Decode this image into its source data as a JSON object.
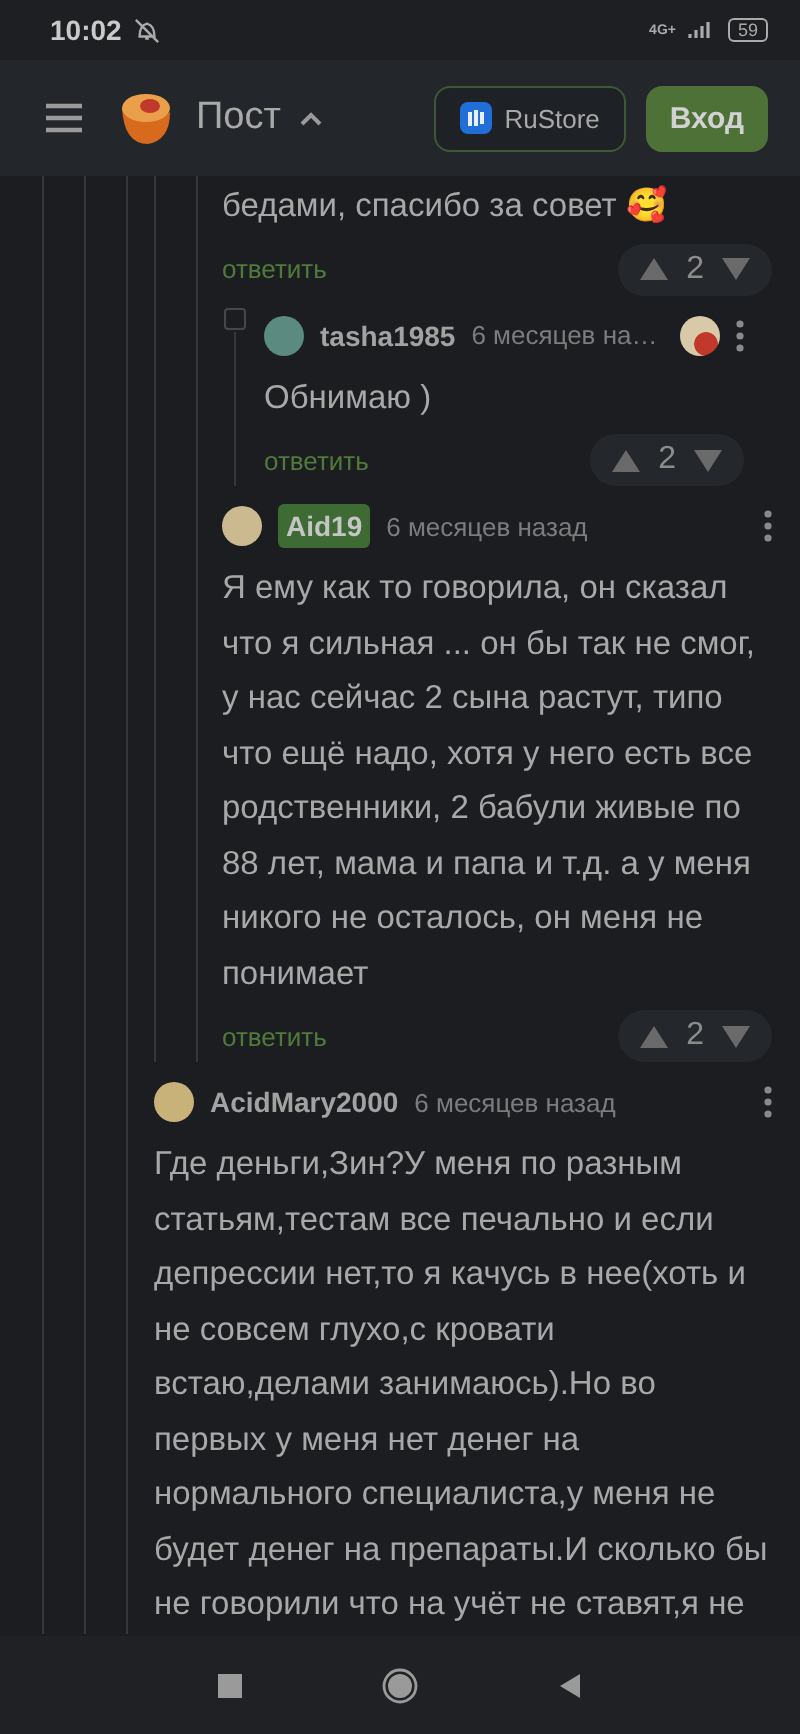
{
  "status_bar": {
    "time": "10:02",
    "battery": "59",
    "network": "4G+"
  },
  "header": {
    "title": "Пост",
    "store_button": "RuStore",
    "login_button": "Вход"
  },
  "upper_replies": [
    {
      "kind": "partial",
      "text": "бедами, спасибо за совет 🥰",
      "reply": "ответить",
      "score": "2",
      "children": [
        {
          "kind": "comment",
          "author": "tasha1985",
          "author_badge": false,
          "time": "6 месяцев на…",
          "reaction_avatar": true,
          "text": "Обнимаю )",
          "reply": "ответить",
          "score": "2"
        }
      ]
    },
    {
      "kind": "comment",
      "author": "Aid19",
      "author_badge": true,
      "time": "6 месяцев назад",
      "reaction_avatar": false,
      "text": "Я ему как то говорила, он сказал что я сильная ... он бы так не смог, у нас сейчас 2 сына растут, типо что ещё надо, хотя у него есть все родственники, 2 бабули живые по 88 лет, мама и папа и т.д. а у меня никого не осталось, он меня не понимает",
      "reply": "ответить",
      "score": "2"
    }
  ],
  "comments": [
    {
      "kind": "comment",
      "author": "AcidMary2000",
      "author_badge": false,
      "time": "6 месяцев назад",
      "reaction_avatar": false,
      "text": "Где деньги,Зин?У меня по разным статьям,тестам все печально и если депрессии нет,то я качусь в нее(хоть и не совсем глухо,с кровати встаю,делами занимаюсь).Но во первых у меня нет денег на нормального специалиста,у меня не будет денег на препараты.И сколько бы не говорили что на учёт не ставят,я не"
    }
  ]
}
